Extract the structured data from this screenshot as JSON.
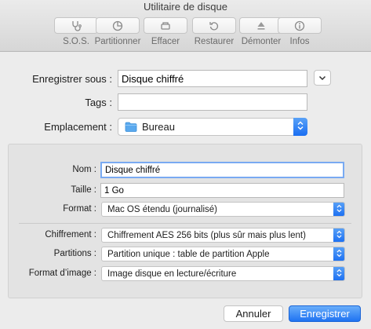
{
  "window": {
    "title": "Utilitaire de disque"
  },
  "toolbar": {
    "items": [
      {
        "label": "S.O.S.",
        "icon": "stethoscope-icon"
      },
      {
        "label": "Partitionner",
        "icon": "pie-chart-icon"
      },
      {
        "label": "Effacer",
        "icon": "erase-icon"
      },
      {
        "label": "Restaurer",
        "icon": "restore-icon"
      },
      {
        "label": "Démonter",
        "icon": "eject-icon"
      },
      {
        "label": "Infos",
        "icon": "info-icon"
      }
    ]
  },
  "save_sheet": {
    "save_as_label": "Enregistrer sous :",
    "save_as_value": "Disque chiffré",
    "tags_label": "Tags :",
    "tags_value": "",
    "location_label": "Emplacement :",
    "location_value": "Bureau"
  },
  "options": {
    "name_label": "Nom :",
    "name_value": "Disque chiffré",
    "size_label": "Taille :",
    "size_value": "1 Go",
    "format_label": "Format :",
    "format_value": "Mac OS étendu (journalisé)",
    "encryption_label": "Chiffrement :",
    "encryption_value": "Chiffrement AES 256 bits (plus sûr mais plus lent)",
    "partitions_label": "Partitions :",
    "partitions_value": "Partition unique : table de partition Apple",
    "image_format_label": "Format d’image :",
    "image_format_value": "Image disque en lecture/écriture"
  },
  "buttons": {
    "cancel": "Annuler",
    "save": "Enregistrer"
  },
  "colors": {
    "accent": "#1f73f2",
    "focus_ring": "#79aaf2",
    "background": "#ececec",
    "panel": "#e3e3e3"
  }
}
